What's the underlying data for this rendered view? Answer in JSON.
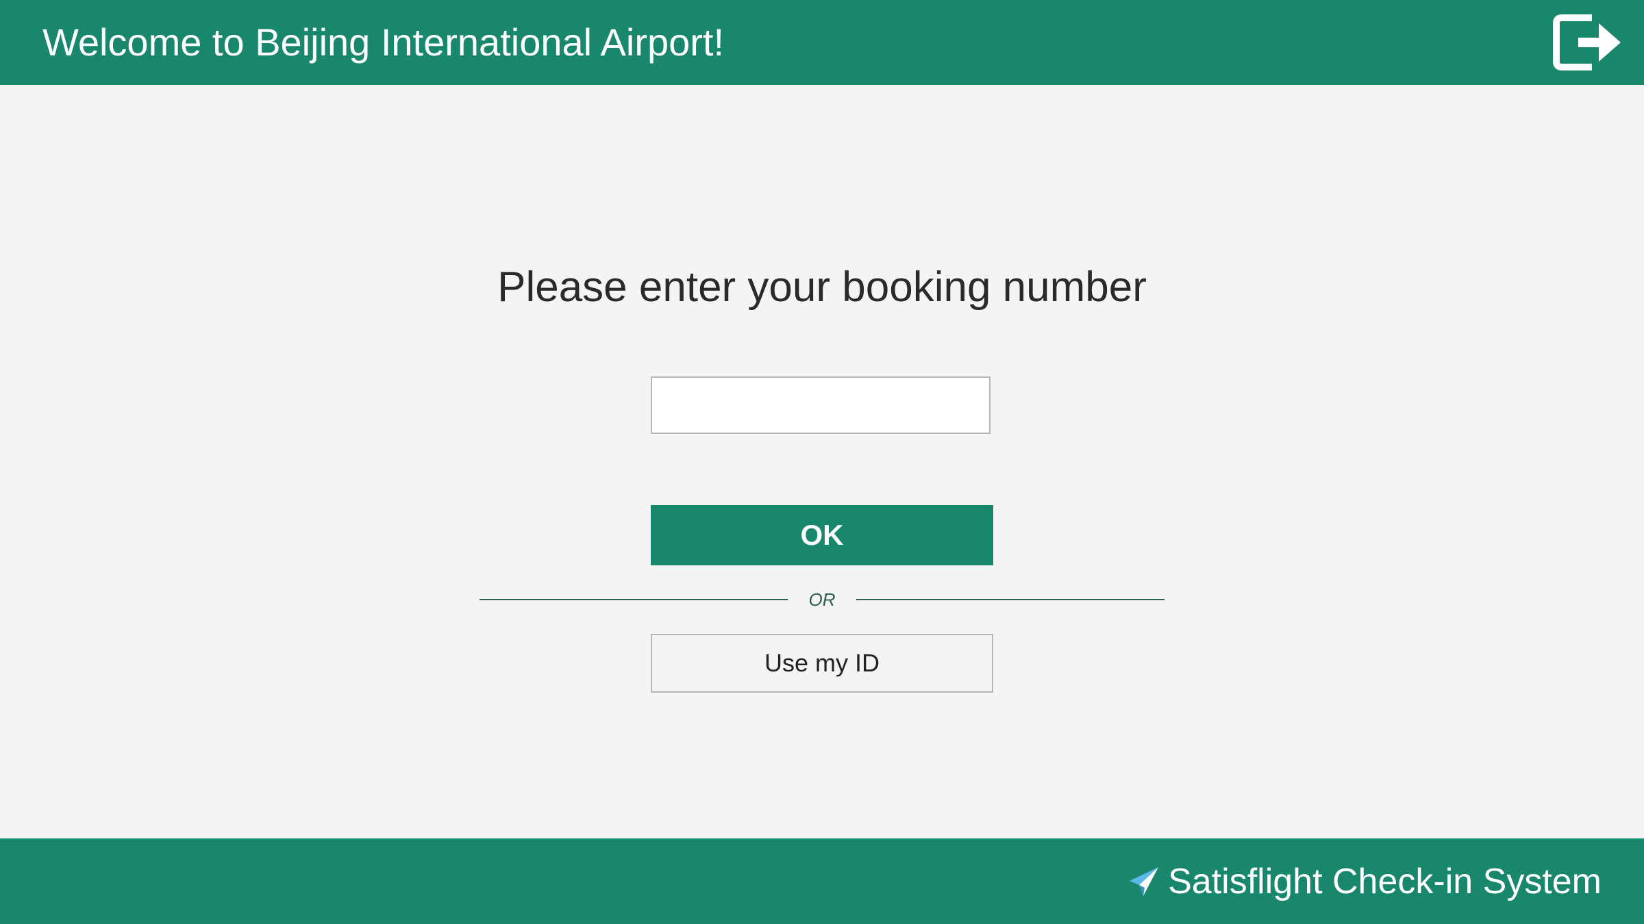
{
  "header": {
    "title": "Welcome to Beijing International Airport!",
    "logout_icon": "logout-icon"
  },
  "main": {
    "prompt": "Please enter your booking number",
    "booking_input": {
      "value": "",
      "placeholder": ""
    },
    "ok_label": "OK",
    "divider_label": "OR",
    "id_button_label": "Use my ID"
  },
  "footer": {
    "brand_icon": "paper-plane-icon",
    "brand_name": "Satisflight Check-in System"
  },
  "colors": {
    "primary": "#19876c",
    "background": "#f4f4f4",
    "text": "#2a2a2a",
    "divider": "#2f5e52",
    "brand_icon": "#5bb8e8"
  }
}
